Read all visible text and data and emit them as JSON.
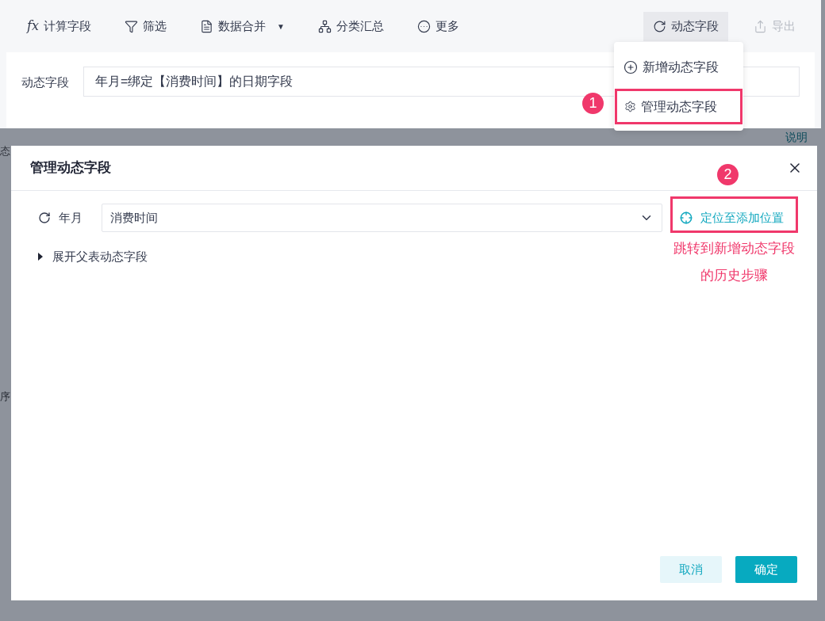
{
  "toolbar": {
    "items": [
      {
        "kind": "formula",
        "icon_text": "fx",
        "label": "计算字段",
        "selected": false,
        "disabled": false
      },
      {
        "kind": "filter",
        "label": "筛选",
        "selected": false,
        "disabled": false
      },
      {
        "kind": "merge",
        "label": "数据合并",
        "dropdown": "▼",
        "selected": false,
        "disabled": false
      },
      {
        "kind": "group",
        "label": "分类汇总",
        "selected": false,
        "disabled": false
      },
      {
        "kind": "more",
        "label": "更多",
        "selected": false,
        "disabled": false
      }
    ],
    "right_items": [
      {
        "kind": "dynamic",
        "label": "动态字段",
        "selected": true,
        "disabled": false
      },
      {
        "kind": "export",
        "label": "导出",
        "selected": false,
        "disabled": true
      }
    ]
  },
  "dropdown_menu": {
    "items": [
      {
        "kind": "add",
        "label": "新增动态字段"
      },
      {
        "kind": "manage",
        "label": "管理动态字段"
      }
    ]
  },
  "dynamic_field_bar": {
    "label": "动态字段",
    "value": "年月=绑定【消费时间】的日期字段"
  },
  "background": {
    "fragments": [
      {
        "kind": "left-top",
        "text": "态"
      },
      {
        "kind": "right",
        "text": "说明"
      },
      {
        "kind": "left-mid",
        "text": "序"
      }
    ]
  },
  "dialog": {
    "title": "管理动态字段",
    "rows": [
      {
        "name": "年月",
        "value": "消费时间"
      }
    ],
    "locate_button": "定位至添加位置",
    "expander": {
      "label": "展开父表动态字段",
      "expanded": false
    },
    "buttons": [
      {
        "kind": "secondary",
        "label": "取消"
      },
      {
        "kind": "primary",
        "label": "确定"
      }
    ]
  },
  "annotations": [
    {
      "number": "1"
    },
    {
      "number": "2",
      "note_lines": [
        "跳转到新增动态字段",
        "的历史步骤"
      ]
    }
  ]
}
